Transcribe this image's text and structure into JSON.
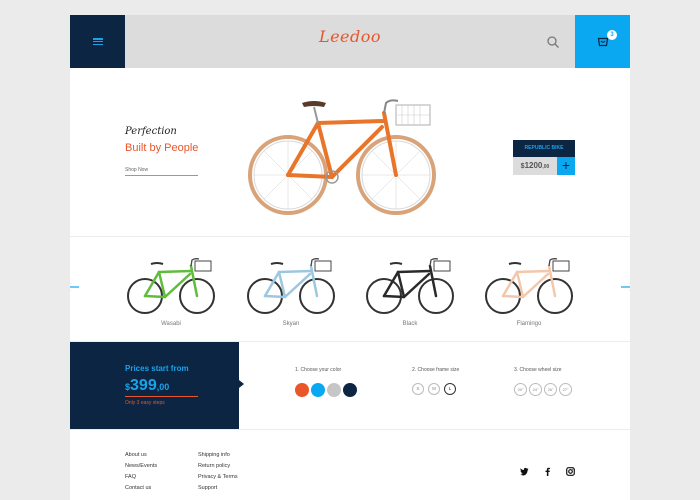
{
  "header": {
    "logo": "Leedoo",
    "cart_count": "3",
    "icons": {
      "menu": "hamburger-menu-icon",
      "search": "search-icon",
      "cart": "cart-icon"
    }
  },
  "hero": {
    "script_title": "Perfection",
    "title": "Built by People",
    "link": "Shop Now",
    "product_name": "REPUBLIC BIKE",
    "price_currency": "$",
    "price_int": "1200",
    "price_dec": ",00",
    "add_label": "+"
  },
  "carousel": {
    "items": [
      {
        "name": "Wasabi",
        "color": "#5fbd3c"
      },
      {
        "name": "Skyan",
        "color": "#9bc8e0"
      },
      {
        "name": "Black",
        "color": "#2a2a2a"
      },
      {
        "name": "Flamingo",
        "color": "#f3c7a9"
      }
    ]
  },
  "config": {
    "promo_title": "Prices start from",
    "price_currency": "$",
    "price_int": "399",
    "price_dec": ",00",
    "note": "Only 3 easy steps",
    "color_label": "1. Choose your color",
    "colors": [
      "#e8562a",
      "#0aa8f0",
      "#c6c6c6",
      "#0b2543"
    ],
    "frame_label": "2. Choose frame size",
    "frame_sizes": [
      "S",
      "M",
      "L"
    ],
    "frame_selected": "L",
    "wheel_label": "3. Choose wheel size",
    "wheel_sizes": [
      "20\"",
      "24\"",
      "26\"",
      "27\""
    ]
  },
  "footer": {
    "col1": [
      "About us",
      "News/Events",
      "FAQ",
      "Contact us"
    ],
    "col2": [
      "Shipping info",
      "Return policy",
      "Privacy & Terms",
      "Support"
    ],
    "social": [
      "twitter-icon",
      "facebook-icon",
      "instagram-icon"
    ]
  },
  "colors": {
    "navy": "#0b2543",
    "blue": "#0aa8f0",
    "orange": "#e8562a",
    "header_grey": "#dcdcdc"
  }
}
